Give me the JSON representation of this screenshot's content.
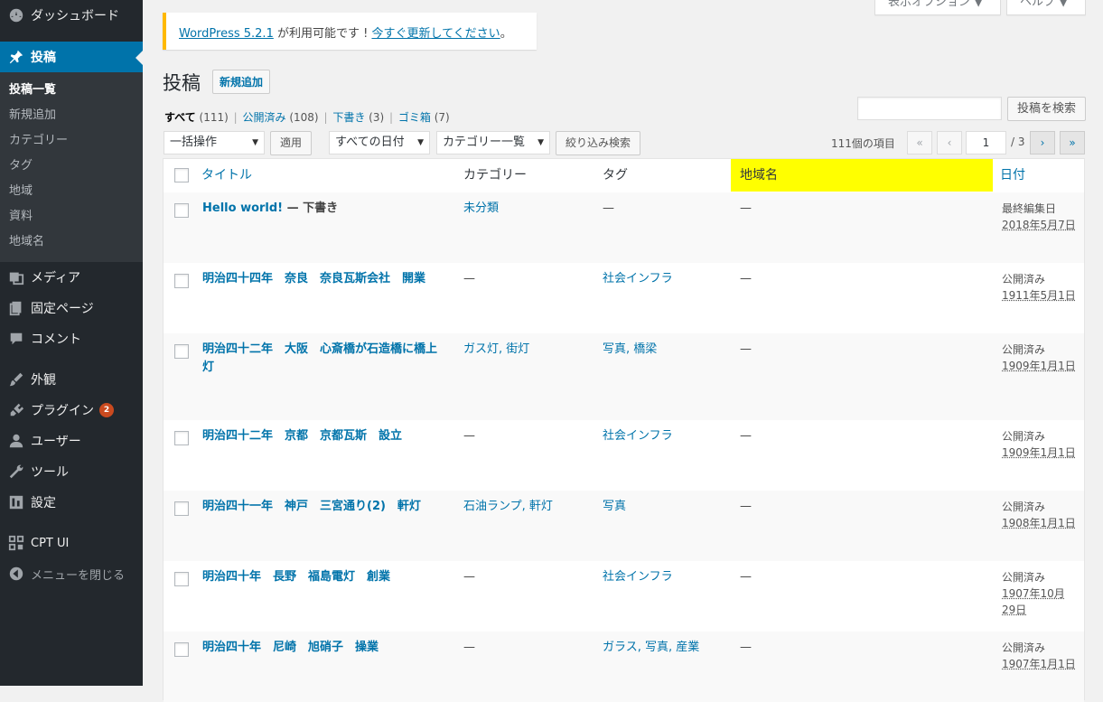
{
  "sidebar": {
    "items": [
      {
        "label": "ダッシュボード",
        "icon": "dashboard-icon"
      },
      {
        "label": "投稿",
        "icon": "pin-icon"
      },
      {
        "label": "メディア",
        "icon": "media-icon"
      },
      {
        "label": "固定ページ",
        "icon": "page-icon"
      },
      {
        "label": "コメント",
        "icon": "comment-icon"
      },
      {
        "label": "外観",
        "icon": "brush-icon"
      },
      {
        "label": "プラグイン",
        "icon": "plugin-icon",
        "badge": "2"
      },
      {
        "label": "ユーザー",
        "icon": "user-icon"
      },
      {
        "label": "ツール",
        "icon": "wrench-icon"
      },
      {
        "label": "設定",
        "icon": "settings-icon"
      },
      {
        "label": "CPT UI",
        "icon": "grid-icon"
      },
      {
        "label": "メニューを閉じる",
        "icon": "collapse-icon"
      }
    ],
    "submenu": [
      "投稿一覧",
      "新規追加",
      "カテゴリー",
      "タグ",
      "地域",
      "資料",
      "地域名"
    ]
  },
  "top": {
    "screen_options": "表示オプション ▼",
    "help": "ヘルプ ▼"
  },
  "notice": {
    "link1": "WordPress 5.2.1",
    "text": " が利用可能です ! ",
    "link2": "今すぐ更新してください",
    "end": "。"
  },
  "page": {
    "title": "投稿",
    "add_new": "新規追加"
  },
  "views": {
    "all": "すべて",
    "all_count": "(111)",
    "published": "公開済み",
    "published_count": "(108)",
    "draft": "下書き",
    "draft_count": "(3)",
    "trash": "ゴミ箱",
    "trash_count": "(7)"
  },
  "search": {
    "button": "投稿を検索",
    "value": ""
  },
  "filters": {
    "bulk": "一括操作",
    "apply": "適用",
    "dates": "すべての日付",
    "categories": "カテゴリー一覧",
    "filter": "絞り込み検索"
  },
  "pagination": {
    "items": "111個の項目",
    "first": "«",
    "prev": "‹",
    "current": "1",
    "total": "/ 3",
    "next": "›",
    "last": "»"
  },
  "columns": {
    "title": "タイトル",
    "category": "カテゴリー",
    "tag": "タグ",
    "region": "地域名",
    "date": "日付"
  },
  "rows": [
    {
      "title": "Hello world!",
      "state": " — 下書き",
      "category": "未分類",
      "tags": "—",
      "region": "—",
      "status": "最終編集日",
      "date": "2018年5月7日"
    },
    {
      "title": "明治四十四年　奈良　奈良瓦斯会社　開業",
      "state": "",
      "category": "—",
      "tags": "社会インフラ",
      "region": "—",
      "status": "公開済み",
      "date": "1911年5月1日"
    },
    {
      "title": "明治四十二年　大阪　心斎橋が石造橋に橋上灯",
      "state": "",
      "category": "ガス灯, 街灯",
      "tags": "写真, 橋梁",
      "region": "—",
      "status": "公開済み",
      "date": "1909年1月1日"
    },
    {
      "title": "明治四十二年　京都　京都瓦斯　設立",
      "state": "",
      "category": "—",
      "tags": "社会インフラ",
      "region": "—",
      "status": "公開済み",
      "date": "1909年1月1日"
    },
    {
      "title": "明治四十一年　神戸　三宮通り(2)　軒灯",
      "state": "",
      "category": "石油ランプ, 軒灯",
      "tags": "写真",
      "region": "—",
      "status": "公開済み",
      "date": "1908年1月1日"
    },
    {
      "title": "明治四十年　長野　福島電灯　創業",
      "state": "",
      "category": "—",
      "tags": "社会インフラ",
      "region": "—",
      "status": "公開済み",
      "date": "1907年10月29日"
    },
    {
      "title": "明治四十年　尼崎　旭硝子　操業",
      "state": "",
      "category": "—",
      "tags": "ガラス, 写真, 産業",
      "region": "—",
      "status": "公開済み",
      "date": "1907年1月1日"
    }
  ]
}
